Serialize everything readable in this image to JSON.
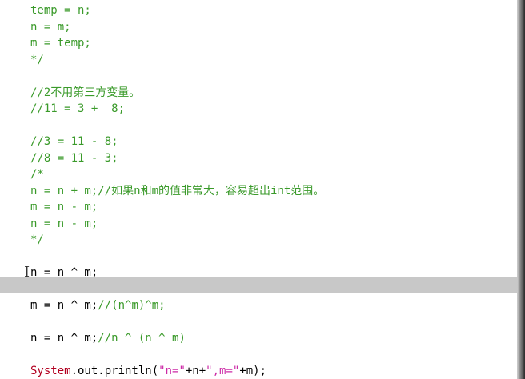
{
  "editor": {
    "lines": [
      {
        "segments": [
          {
            "t": "temp = n;",
            "c": "comment"
          }
        ]
      },
      {
        "segments": [
          {
            "t": "n = m;",
            "c": "comment"
          }
        ]
      },
      {
        "segments": [
          {
            "t": "m = temp;",
            "c": "comment"
          }
        ]
      },
      {
        "segments": [
          {
            "t": "*/",
            "c": "comment"
          }
        ]
      },
      {
        "segments": []
      },
      {
        "segments": [
          {
            "t": "//2不用第三方变量。",
            "c": "comment"
          }
        ]
      },
      {
        "segments": [
          {
            "t": "//11 = 3 +  8;",
            "c": "comment"
          }
        ]
      },
      {
        "segments": []
      },
      {
        "segments": [
          {
            "t": "//3 = 11 - 8;",
            "c": "comment"
          }
        ]
      },
      {
        "segments": [
          {
            "t": "//8 = 11 - 3;",
            "c": "comment"
          }
        ]
      },
      {
        "segments": [
          {
            "t": "/*",
            "c": "comment"
          }
        ]
      },
      {
        "segments": [
          {
            "t": "n = n + m;//如果n和m的值非常大，容易超出int范围。",
            "c": "comment"
          }
        ]
      },
      {
        "segments": [
          {
            "t": "m = n - m;",
            "c": "comment"
          }
        ]
      },
      {
        "segments": [
          {
            "t": "n = n - m;",
            "c": "comment"
          }
        ]
      },
      {
        "segments": [
          {
            "t": "*/",
            "c": "comment"
          }
        ]
      },
      {
        "segments": []
      },
      {
        "segments": [
          {
            "t": "n = n ^ m;",
            "c": "code"
          }
        ]
      },
      {
        "segments": []
      },
      {
        "segments": [
          {
            "t": "m = n ^ m;",
            "c": "code"
          },
          {
            "t": "//(n^m)^m;",
            "c": "comment"
          }
        ]
      },
      {
        "segments": []
      },
      {
        "segments": [
          {
            "t": "n = n ^ m;",
            "c": "code"
          },
          {
            "t": "//n ^ (n ^ m)",
            "c": "comment"
          }
        ]
      },
      {
        "segments": []
      },
      {
        "segments": [
          {
            "t": "System",
            "c": "class"
          },
          {
            "t": ".out.println(",
            "c": "code"
          },
          {
            "t": "\"n=\"",
            "c": "string"
          },
          {
            "t": "+n+",
            "c": "code"
          },
          {
            "t": "\",m=\"",
            "c": "string"
          },
          {
            "t": "+m);",
            "c": "code"
          }
        ]
      }
    ]
  }
}
